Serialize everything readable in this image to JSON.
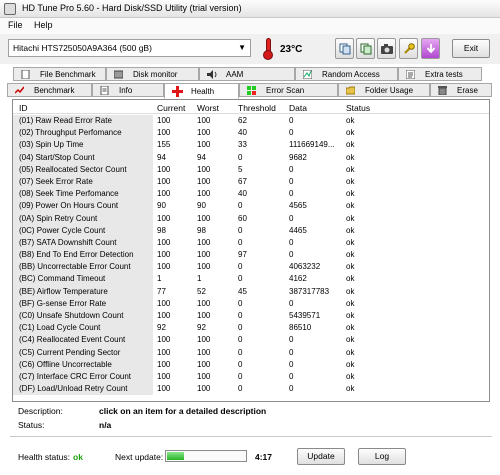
{
  "window": {
    "title": "HD Tune Pro 5.60 - Hard Disk/SSD Utility (trial version)"
  },
  "menu": {
    "file": "File",
    "help": "Help"
  },
  "toolbar": {
    "drive": "Hitachi HTS725050A9A364 (500 gB)",
    "temperature": "23°C",
    "exit_label": "Exit"
  },
  "tabs_top": [
    {
      "label": "File Benchmark",
      "icon": "file-benchmark-icon"
    },
    {
      "label": "Disk monitor",
      "icon": "disk-monitor-icon"
    },
    {
      "label": "AAM",
      "icon": "speaker-icon"
    },
    {
      "label": "Random Access",
      "icon": "random-access-icon"
    },
    {
      "label": "Extra tests",
      "icon": "extra-tests-icon"
    }
  ],
  "tabs_bottom": [
    {
      "label": "Benchmark",
      "icon": "benchmark-icon"
    },
    {
      "label": "Info",
      "icon": "info-icon"
    },
    {
      "label": "Health",
      "icon": "health-cross-icon"
    },
    {
      "label": "Error Scan",
      "icon": "error-scan-icon"
    },
    {
      "label": "Folder Usage",
      "icon": "folder-icon"
    },
    {
      "label": "Erase",
      "icon": "trash-icon"
    }
  ],
  "table": {
    "headers": {
      "id": "ID",
      "current": "Current",
      "worst": "Worst",
      "threshold": "Threshold",
      "data": "Data",
      "status": "Status"
    },
    "rows": [
      [
        "(01) Raw Read Error Rate",
        "100",
        "100",
        "62",
        "0",
        "ok"
      ],
      [
        "(02) Throughput Perfomance",
        "100",
        "100",
        "40",
        "0",
        "ok"
      ],
      [
        "(03) Spin Up Time",
        "155",
        "100",
        "33",
        "111669149...",
        "ok"
      ],
      [
        "(04) Start/Stop Count",
        "94",
        "94",
        "0",
        "9682",
        "ok"
      ],
      [
        "(05) Reallocated Sector Count",
        "100",
        "100",
        "5",
        "0",
        "ok"
      ],
      [
        "(07) Seek Error Rate",
        "100",
        "100",
        "67",
        "0",
        "ok"
      ],
      [
        "(08) Seek Time Perfomance",
        "100",
        "100",
        "40",
        "0",
        "ok"
      ],
      [
        "(09) Power On Hours Count",
        "90",
        "90",
        "0",
        "4565",
        "ok"
      ],
      [
        "(0A) Spin Retry Count",
        "100",
        "100",
        "60",
        "0",
        "ok"
      ],
      [
        "(0C) Power Cycle Count",
        "98",
        "98",
        "0",
        "4465",
        "ok"
      ],
      [
        "(B7) SATA Downshift Count",
        "100",
        "100",
        "0",
        "0",
        "ok"
      ],
      [
        "(B8) End To End Error Detection",
        "100",
        "100",
        "97",
        "0",
        "ok"
      ],
      [
        "(BB) Uncorrectable Error Count",
        "100",
        "100",
        "0",
        "4063232",
        "ok"
      ],
      [
        "(BC) Command Timeout",
        "1",
        "1",
        "0",
        "4162",
        "ok"
      ],
      [
        "(BE) Airflow Temperature",
        "77",
        "52",
        "45",
        "387317783",
        "ok"
      ],
      [
        "(BF) G-sense Error Rate",
        "100",
        "100",
        "0",
        "0",
        "ok"
      ],
      [
        "(C0) Unsafe Shutdown Count",
        "100",
        "100",
        "0",
        "5439571",
        "ok"
      ],
      [
        "(C1) Load Cycle Count",
        "92",
        "92",
        "0",
        "86510",
        "ok"
      ],
      [
        "(C4) Reallocated Event Count",
        "100",
        "100",
        "0",
        "0",
        "ok"
      ],
      [
        "(C5) Current Pending Sector",
        "100",
        "100",
        "0",
        "0",
        "ok"
      ],
      [
        "(C6) Offline Uncorrectable",
        "100",
        "100",
        "0",
        "0",
        "ok"
      ],
      [
        "(C7) Interface CRC Error Count",
        "100",
        "100",
        "0",
        "0",
        "ok"
      ],
      [
        "(DF) Load/Unload Retry Count",
        "100",
        "100",
        "0",
        "0",
        "ok"
      ]
    ]
  },
  "description": {
    "label": "Description:",
    "value": "click on an item for a detailed description",
    "status_label": "Status:",
    "status_value": "n/a"
  },
  "statusbar": {
    "health_label": "Health status:",
    "health_value": "ok",
    "next_update_label": "Next update:",
    "progress_fraction": 0.22,
    "time": "4:17",
    "update_label": "Update",
    "log_label": "Log"
  },
  "colors": {
    "health_ok": "#1ca20d",
    "progress_fill": "#28b428"
  }
}
